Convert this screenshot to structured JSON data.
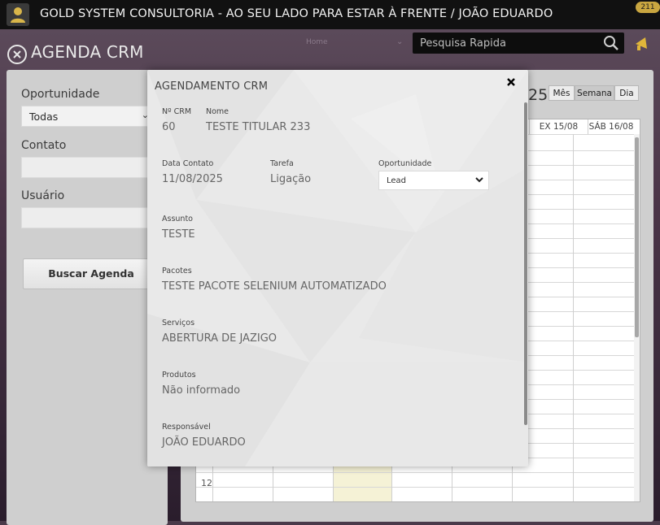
{
  "topbar": {
    "title": "GOLD SYSTEM CONSULTORIA - AO SEU LADO PARA ESTAR À FRENTE / JOÃO EDUARDO",
    "badge": "211",
    "user_icon": "user-icon"
  },
  "header": {
    "page_title": "AGENDA CRM",
    "home_link": "Home",
    "search_placeholder": "Pesquisa Rapida"
  },
  "filters": {
    "opportunity_label": "Oportunidade",
    "opportunity_value": "Todas",
    "contact_label": "Contato",
    "user_label": "Usuário",
    "search_button": "Buscar Agenda"
  },
  "calendar": {
    "date_title_fragment": "25",
    "views": [
      "Mês",
      "Semana",
      "Dia"
    ],
    "active_view": "Semana",
    "columns": [
      "EX 15/08",
      "SÁB 16/08"
    ],
    "hour_label": "12"
  },
  "modal": {
    "title": "AGENDAMENTO CRM",
    "crm_number_label": "Nº CRM",
    "crm_number": "60",
    "name_label": "Nome",
    "name": "TESTE TITULAR 233",
    "contact_date_label": "Data Contato",
    "contact_date": "11/08/2025",
    "task_label": "Tarefa",
    "task": "Ligação",
    "opportunity_label": "Oportunidade",
    "opportunity_value": "Lead",
    "subject_label": "Assunto",
    "subject": "TESTE",
    "packages_label": "Pacotes",
    "packages": "TESTE PACOTE SELENIUM AUTOMATIZADO",
    "services_label": "Serviços",
    "services": "ABERTURA DE JAZIGO",
    "products_label": "Produtos",
    "products": "Não informado",
    "responsible_label": "Responsável",
    "responsible": "JOÃO EDUARDO"
  },
  "colors": {
    "topbar": "#111111",
    "accent_gold": "#c9a640",
    "today_highlight": "#f5f2d6"
  }
}
